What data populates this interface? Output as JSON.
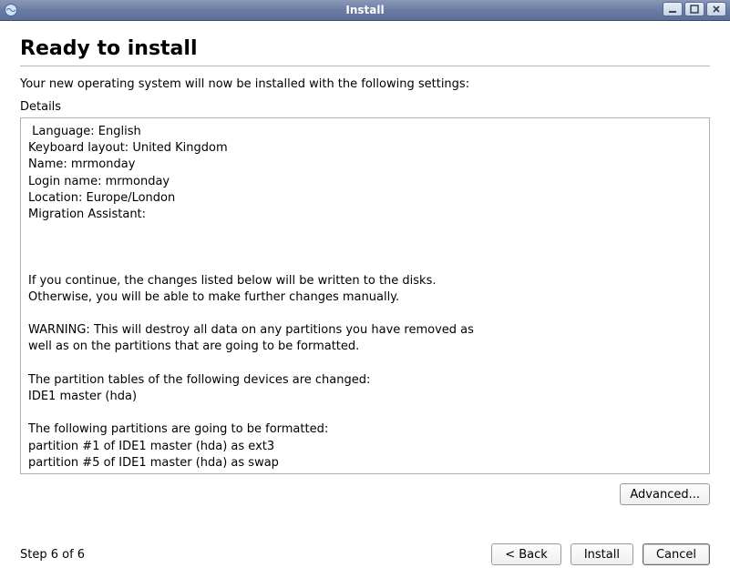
{
  "window": {
    "title": "Install"
  },
  "page": {
    "heading": "Ready to install",
    "intro": "Your new operating system will now be installed with the following settings:",
    "details_label": "Details",
    "details_text": " Language: English\nKeyboard layout: United Kingdom\nName: mrmonday\nLogin name: mrmonday\nLocation: Europe/London\nMigration Assistant:\n\n\n\nIf you continue, the changes listed below will be written to the disks.\nOtherwise, you will be able to make further changes manually.\n\nWARNING: This will destroy all data on any partitions you have removed as\nwell as on the partitions that are going to be formatted.\n\nThe partition tables of the following devices are changed:\nIDE1 master (hda)\n\nThe following partitions are going to be formatted:\npartition #1 of IDE1 master (hda) as ext3\npartition #5 of IDE1 master (hda) as swap"
  },
  "buttons": {
    "advanced": "Advanced...",
    "back": "< Back",
    "install": "Install",
    "cancel": "Cancel"
  },
  "footer": {
    "step": "Step 6 of 6"
  }
}
